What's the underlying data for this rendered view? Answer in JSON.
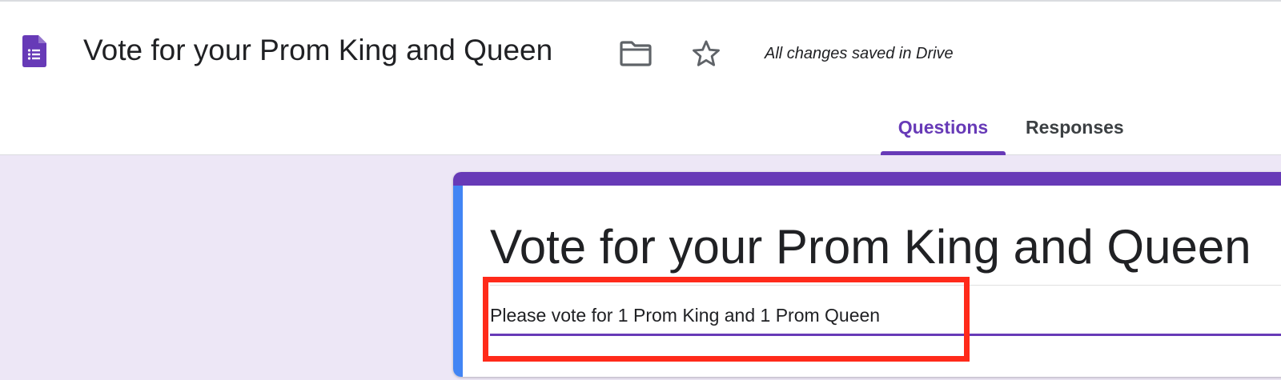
{
  "header": {
    "app_icon": "google-forms-icon",
    "title": "Vote for your Prom King and Queen",
    "folder_icon": "folder-icon",
    "star_icon": "star-icon",
    "save_status": "All changes saved in Drive"
  },
  "tabs": [
    {
      "label": "Questions",
      "active": true
    },
    {
      "label": "Responses",
      "active": false
    }
  ],
  "form": {
    "title": "Vote for your Prom King and Queen",
    "description": "Please vote for 1 Prom King and 1 Prom Queen"
  },
  "colors": {
    "accent": "#673ab7",
    "card_left_border": "#4285f4",
    "page_background": "#ede7f6",
    "highlight": "#ff2a1a"
  }
}
